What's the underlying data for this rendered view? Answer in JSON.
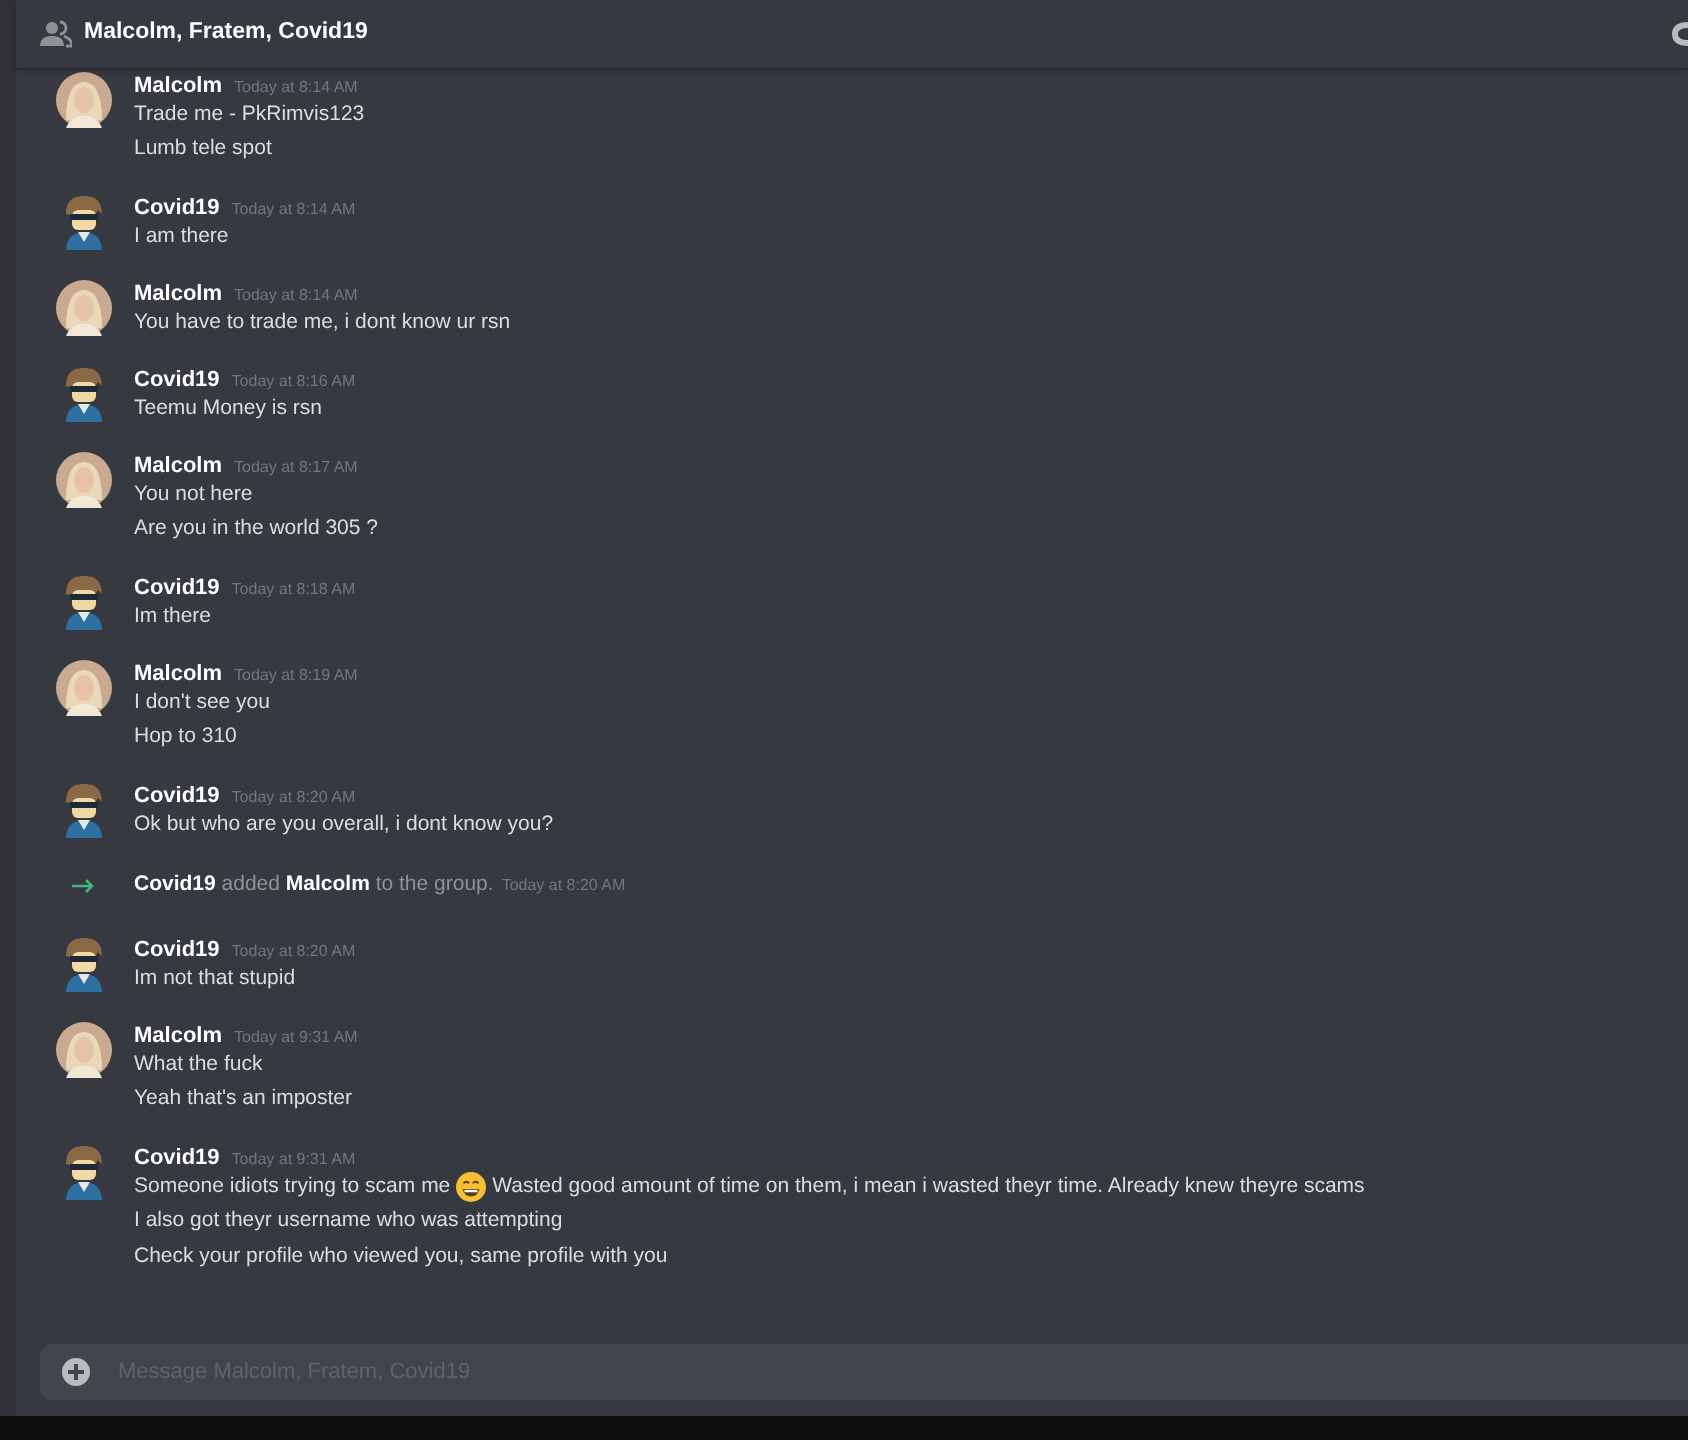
{
  "header": {
    "title": "Malcolm, Fratem, Covid19"
  },
  "messages": [
    {
      "kind": "message",
      "avatar": {
        "kind": "photo"
      },
      "author": "Malcolm",
      "time": "Today at 8:14 AM",
      "lines": [
        {
          "text": "Trade me - PkRimvis123"
        },
        {
          "text": "Lumb tele spot"
        }
      ]
    },
    {
      "kind": "message",
      "avatar": {
        "kind": "cartoon"
      },
      "author": "Covid19",
      "time": "Today at 8:14 AM",
      "lines": [
        {
          "text": "I am there"
        }
      ]
    },
    {
      "kind": "message",
      "avatar": {
        "kind": "photo"
      },
      "author": "Malcolm",
      "time": "Today at 8:14 AM",
      "lines": [
        {
          "text": "You have to trade me, i dont know ur rsn"
        }
      ]
    },
    {
      "kind": "message",
      "avatar": {
        "kind": "cartoon"
      },
      "author": "Covid19",
      "time": "Today at 8:16 AM",
      "lines": [
        {
          "text": "Teemu Money is rsn"
        }
      ]
    },
    {
      "kind": "message",
      "avatar": {
        "kind": "photo"
      },
      "author": "Malcolm",
      "time": "Today at 8:17 AM",
      "lines": [
        {
          "text": "You not here"
        },
        {
          "text": "Are you in the world 305 ?"
        }
      ]
    },
    {
      "kind": "message",
      "avatar": {
        "kind": "cartoon"
      },
      "author": "Covid19",
      "time": "Today at 8:18 AM",
      "lines": [
        {
          "text": "Im there"
        }
      ]
    },
    {
      "kind": "message",
      "avatar": {
        "kind": "photo"
      },
      "author": "Malcolm",
      "time": "Today at 8:19 AM",
      "lines": [
        {
          "text": "I don't see you"
        },
        {
          "text": "Hop to 310"
        }
      ]
    },
    {
      "kind": "message",
      "avatar": {
        "kind": "cartoon"
      },
      "author": "Covid19",
      "time": "Today at 8:20 AM",
      "lines": [
        {
          "text": "Ok but who are you overall, i dont know you?"
        }
      ]
    },
    {
      "kind": "system",
      "text": "**Covid19** added **Malcolm** to the group.",
      "time": "Today at 8:20 AM"
    },
    {
      "kind": "message",
      "avatar": {
        "kind": "cartoon"
      },
      "author": "Covid19",
      "time": "Today at 8:20 AM",
      "lines": [
        {
          "text": "Im not that stupid"
        }
      ]
    },
    {
      "kind": "message",
      "avatar": {
        "kind": "photo"
      },
      "author": "Malcolm",
      "time": "Today at 9:31 AM",
      "lines": [
        {
          "text": "What the fuck"
        },
        {
          "text": "Yeah that's an imposter"
        }
      ]
    },
    {
      "kind": "message",
      "avatar": {
        "kind": "cartoon"
      },
      "author": "Covid19",
      "time": "Today at 9:31 AM",
      "lines": [
        {
          "before": "Someone idiots trying to scam me",
          "emoji": {
            "kind": "grin"
          },
          "after": "Wasted good amount of time on them, i mean i wasted theyr time. Already knew theyre scams"
        },
        {
          "text": "I also got theyr username who was attempting"
        },
        {
          "text": "Check your profile who viewed you, same profile with you"
        }
      ]
    }
  ],
  "composer": {
    "placeholder": "Message Malcolm, Fratem, Covid19"
  }
}
